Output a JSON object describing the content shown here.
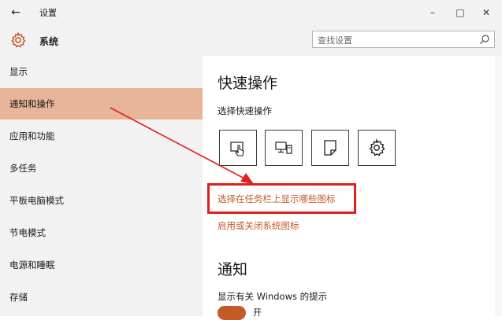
{
  "window": {
    "title": "设置",
    "back_glyph": "←",
    "minimize_glyph": "–",
    "maximize_glyph": "□",
    "close_glyph": "✕"
  },
  "header": {
    "app_title": "系统",
    "search_placeholder": "查找设置"
  },
  "sidebar": {
    "items": [
      {
        "label": "显示"
      },
      {
        "label": "通知和操作",
        "active": true
      },
      {
        "label": "应用和功能"
      },
      {
        "label": "多任务"
      },
      {
        "label": "平板电脑模式"
      },
      {
        "label": "节电模式"
      },
      {
        "label": "电源和睡眠"
      },
      {
        "label": "存储"
      }
    ]
  },
  "content": {
    "quick_actions_title": "快速操作",
    "quick_actions_label": "选择快速操作",
    "quick_action_icons": [
      "tablet-touch-icon",
      "project-display-icon",
      "note-icon",
      "settings-gear-icon"
    ],
    "taskbar_icons_link": "选择在任务栏上显示哪些图标",
    "system_icons_link": "启用或关闭系统图标",
    "notifications_title": "通知",
    "windows_tips_label": "显示有关 Windows 的提示",
    "toggle_state": "开"
  },
  "colors": {
    "accent": "#c35a2a",
    "active_nav": "#e8b49a",
    "annotation_red": "#e0201c"
  }
}
